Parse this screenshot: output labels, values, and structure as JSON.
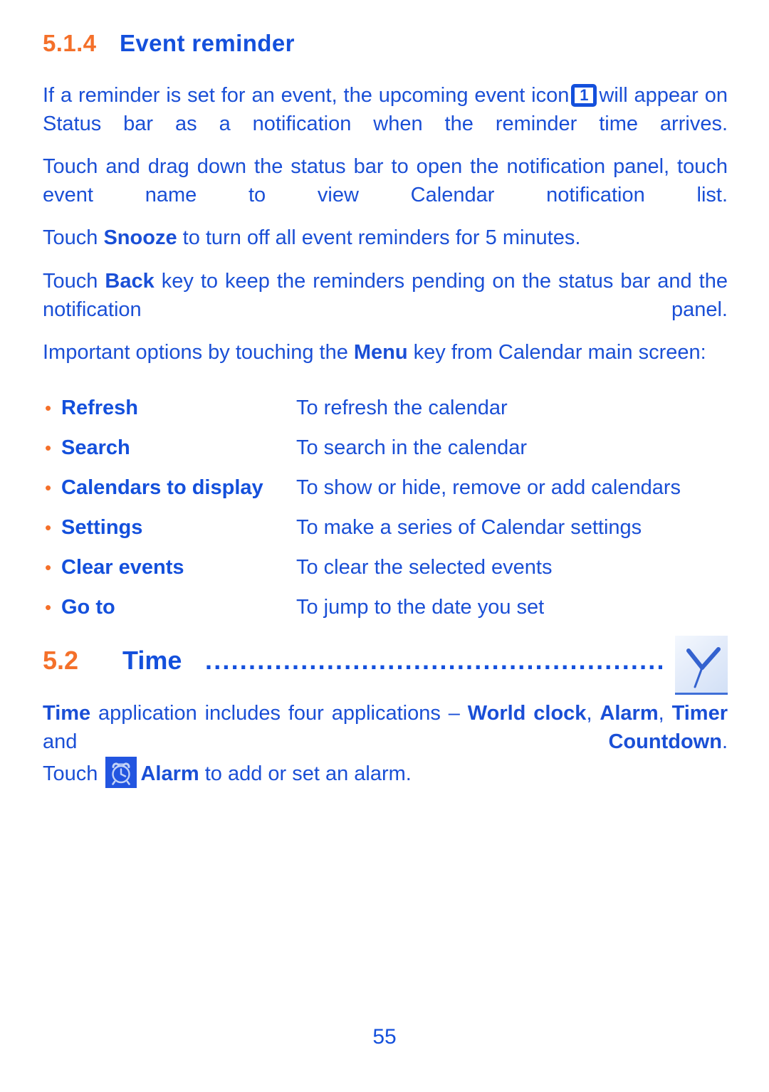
{
  "document": {
    "page_number": "55",
    "colors": {
      "heading_orange": "#f4702a",
      "text_blue": "#1a4fd6",
      "heading_blue": "#1450dc",
      "bullet_orange": "#f4702a"
    }
  },
  "section_514": {
    "number": "5.1.4",
    "title": "Event reminder",
    "paragraph_1_before_icon": "If a reminder is set for an event, the upcoming event icon",
    "calendar_icon_label": "1",
    "paragraph_1_after_icon": "will appear on Status bar as a notification when the reminder time arrives.",
    "paragraph_2": "Touch and drag down the status bar to open the notification panel, touch event name to view Calendar notification list.",
    "paragraph_3_part1": "Touch ",
    "paragraph_3_bold": "Snooze",
    "paragraph_3_part2": " to turn off all event reminders for 5 minutes.",
    "paragraph_4_part1": "Touch ",
    "paragraph_4_bold": "Back",
    "paragraph_4_part2": " key to keep the reminders pending on the status bar and the notification panel.",
    "paragraph_5_part1": "Important options by touching the ",
    "paragraph_5_bold": "Menu",
    "paragraph_5_part2": " key from Calendar main screen:"
  },
  "options": {
    "bullet_glyph": "•",
    "items": [
      {
        "label": "Refresh",
        "description": "To refresh the calendar"
      },
      {
        "label": "Search",
        "description": "To search in the calendar"
      },
      {
        "label": "Calendars to display",
        "description": "To show or hide, remove or add calendars"
      },
      {
        "label": "Settings",
        "description": "To make a series of Calendar settings"
      },
      {
        "label": "Clear events",
        "description": "To clear the selected events"
      },
      {
        "label": "Go to",
        "description": "To jump to the date you set"
      }
    ]
  },
  "section_52": {
    "number": "5.2",
    "title": "Time",
    "leader_dots": "..............................................................",
    "paragraph_1_part1": "Time",
    "paragraph_1_part2": " application includes four applications – ",
    "paragraph_1_bold_1": "World clock",
    "paragraph_1_sep_1": ", ",
    "paragraph_1_bold_2": "Alarm",
    "paragraph_1_sep_2": ", ",
    "paragraph_1_bold_3": "Timer",
    "paragraph_1_sep_3": " and ",
    "paragraph_1_bold_4": "Countdown",
    "paragraph_1_end": ".",
    "paragraph_2_part1": "Touch ",
    "paragraph_2_bold": "Alarm",
    "paragraph_2_part2": " to add or set an alarm."
  }
}
